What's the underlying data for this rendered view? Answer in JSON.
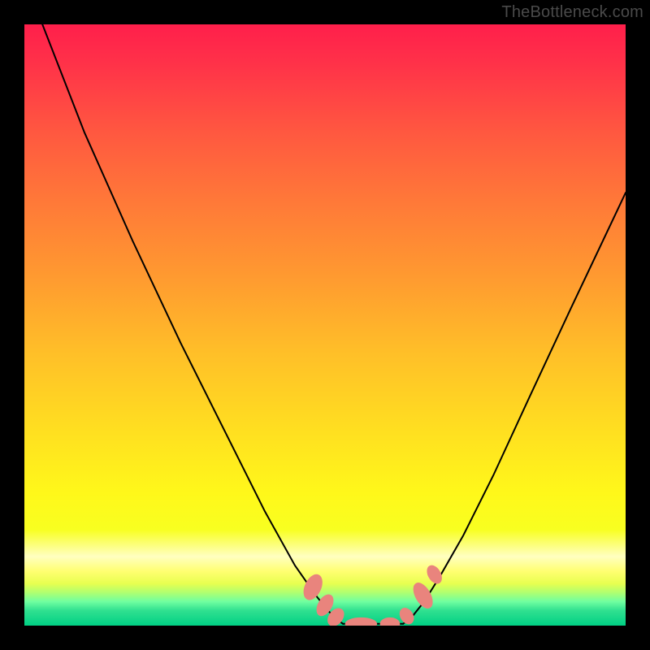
{
  "watermark": "TheBottleneck.com",
  "chart_data": {
    "type": "line",
    "title": "",
    "xlabel": "",
    "ylabel": "",
    "xlim": [
      0,
      100
    ],
    "ylim": [
      0,
      100
    ],
    "series": [
      {
        "name": "left-curve",
        "x": [
          3,
          10,
          18,
          26,
          34,
          40,
          45,
          48.5,
          50.5,
          52,
          53
        ],
        "y": [
          100,
          82,
          64,
          47,
          31,
          19,
          10,
          5,
          2.5,
          1,
          0.3
        ]
      },
      {
        "name": "right-curve",
        "x": [
          63,
          64.5,
          66.5,
          69,
          73,
          78,
          84,
          91,
          100
        ],
        "y": [
          0.3,
          1.5,
          4,
          8,
          15,
          25,
          38,
          53,
          72
        ]
      },
      {
        "name": "flat-bottom",
        "x": [
          53,
          63
        ],
        "y": [
          0.3,
          0.3
        ]
      }
    ],
    "markers": [
      {
        "name": "m1",
        "x": 48.0,
        "y": 6.4,
        "rx": 1.3,
        "ry": 2.2,
        "rot": 25
      },
      {
        "name": "m2",
        "x": 50.0,
        "y": 3.4,
        "rx": 1.1,
        "ry": 1.9,
        "rot": 30
      },
      {
        "name": "m3",
        "x": 51.8,
        "y": 1.4,
        "rx": 1.1,
        "ry": 1.6,
        "rot": 38
      },
      {
        "name": "m4",
        "x": 56.0,
        "y": 0.3,
        "rx": 2.6,
        "ry": 1.0,
        "rot": 0
      },
      {
        "name": "m5",
        "x": 60.8,
        "y": 0.3,
        "rx": 1.6,
        "ry": 1.0,
        "rot": 0
      },
      {
        "name": "m6",
        "x": 63.6,
        "y": 1.6,
        "rx": 1.0,
        "ry": 1.4,
        "rot": -32
      },
      {
        "name": "m7",
        "x": 66.3,
        "y": 5.0,
        "rx": 1.2,
        "ry": 2.3,
        "rot": -30
      },
      {
        "name": "m8",
        "x": 68.2,
        "y": 8.5,
        "rx": 1.0,
        "ry": 1.6,
        "rot": -30
      }
    ],
    "colors": {
      "curve": "#000000",
      "marker_fill": "#e9847d",
      "marker_stroke": "#e9847d"
    }
  }
}
